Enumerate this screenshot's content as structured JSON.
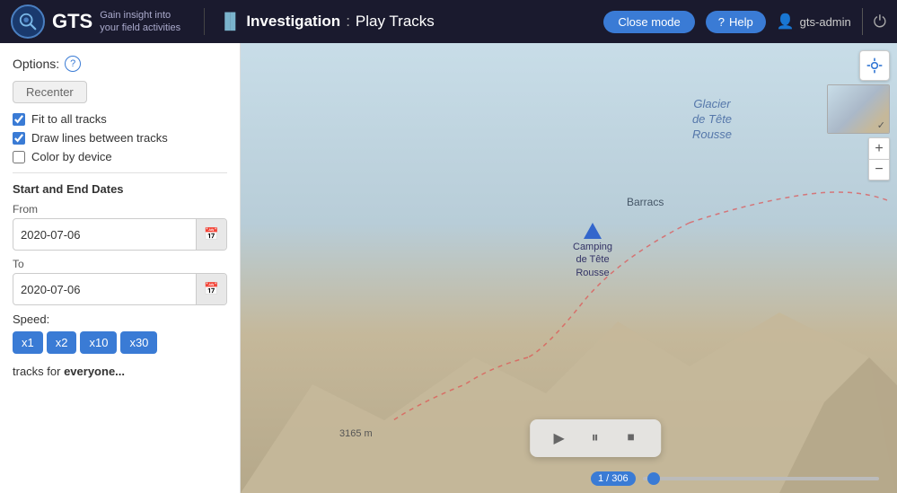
{
  "header": {
    "logo_text": "GTS",
    "logo_tagline": "Gain insight into your field activities",
    "title_icon": "▐▌",
    "title_investigation": "Investigation",
    "title_separator": ":",
    "title_page": "Play Tracks",
    "close_mode_label": "Close mode",
    "help_label": "Help",
    "user_label": "gts-admin"
  },
  "options_panel": {
    "options_label": "Options:",
    "help_icon": "?",
    "recenter_label": "Recenter",
    "checkbox1_label": "Fit to all tracks",
    "checkbox1_checked": true,
    "checkbox2_label": "Draw lines between tracks",
    "checkbox2_checked": true,
    "checkbox3_label": "Color by device",
    "checkbox3_checked": false,
    "section_dates": "Start and End Dates",
    "from_label": "From",
    "from_value": "2020-07-06",
    "to_label": "To",
    "to_value": "2020-07-06",
    "speed_label": "Speed:",
    "speed_buttons": [
      "x1",
      "x2",
      "x10",
      "x30"
    ],
    "speed_active": "x1",
    "tracks_text": "tracks for ",
    "tracks_bold": "everyone..."
  },
  "map": {
    "label_glacier": "Glacier\nde Tête\nRousse",
    "label_barracs": "Barracs",
    "label_camping": "Camping\nde Tête\nRousse",
    "camp_icon": "▲"
  },
  "playback": {
    "play_icon": "▶",
    "pause_icon": "⏸",
    "stop_icon": "⏹",
    "progress_label": "1 / 306"
  },
  "map_controls": {
    "location_icon": "◎",
    "zoom_in": "+",
    "zoom_out": "−"
  }
}
